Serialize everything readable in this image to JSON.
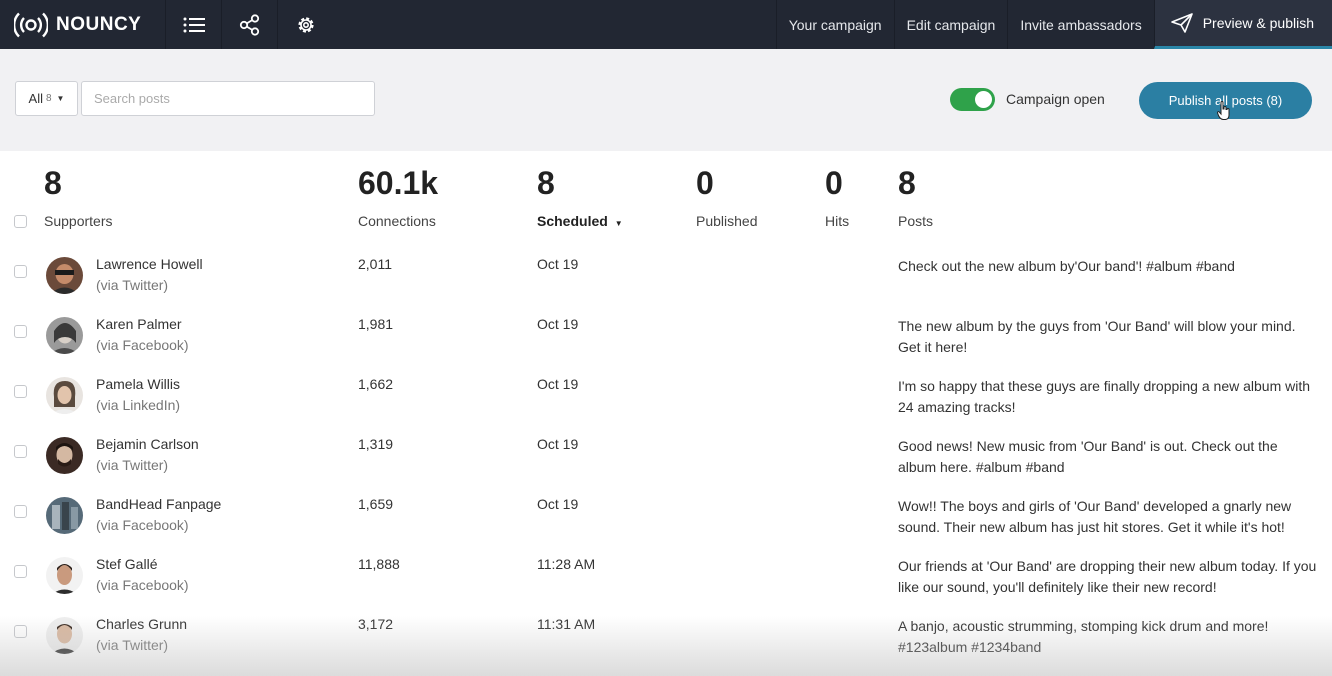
{
  "app": {
    "name": "NOUNCY"
  },
  "nav": {
    "links": [
      "Your campaign",
      "Edit campaign",
      "Invite ambassadors"
    ],
    "active_link": "Preview & publish"
  },
  "toolbar": {
    "filter_label": "All",
    "filter_count": "8",
    "search_placeholder": "Search posts",
    "toggle_label": "Campaign open",
    "toggle_on": true,
    "publish_label": "Publish all posts (8)"
  },
  "stats": [
    {
      "value": "8",
      "label": "Supporters"
    },
    {
      "value": "60.1k",
      "label": "Connections"
    },
    {
      "value": "8",
      "label": "Scheduled"
    },
    {
      "value": "0",
      "label": "Published"
    },
    {
      "value": "0",
      "label": "Hits"
    },
    {
      "value": "8",
      "label": "Posts"
    }
  ],
  "rows": [
    {
      "name": "Lawrence Howell",
      "via": "(via Twitter)",
      "connections": "2,011",
      "scheduled": "Oct 19",
      "post": "Check out the new album by'Our band'! #album #band"
    },
    {
      "name": "Karen Palmer",
      "via": "(via Facebook)",
      "connections": "1,981",
      "scheduled": "Oct 19",
      "post": "The new album by the guys from 'Our Band' will blow your mind. Get it here!"
    },
    {
      "name": "Pamela Willis",
      "via": "(via LinkedIn)",
      "connections": "1,662",
      "scheduled": "Oct 19",
      "post": "I'm so happy that these guys are finally dropping a new album with 24 amazing tracks!"
    },
    {
      "name": "Bejamin Carlson",
      "via": "(via Twitter)",
      "connections": "1,319",
      "scheduled": "Oct 19",
      "post": "Good news! New music from 'Our Band' is out. Check out the album here. #album #band"
    },
    {
      "name": "BandHead Fanpage",
      "via": "(via Facebook)",
      "connections": "1,659",
      "scheduled": "Oct 19",
      "post": "Wow!! The boys and girls of 'Our Band' developed a gnarly new sound. Their new album has just hit stores. Get it while it's hot!"
    },
    {
      "name": "Stef Gallé",
      "via": "(via Facebook)",
      "connections": "11,888",
      "scheduled": "11:28 AM",
      "post": "Our friends at 'Our Band' are dropping their new album today. If you like our sound, you'll definitely like their new record!"
    },
    {
      "name": "Charles Grunn",
      "via": "(via Twitter)",
      "connections": "3,172",
      "scheduled": "11:31 AM",
      "post": "A banjo, acoustic strumming, stomping kick drum and more! #123album #1234band"
    }
  ],
  "colors": {
    "nav_bg": "#222733",
    "accent": "#2b7fa3",
    "toggle_on": "#2fa24a",
    "toolbar_bg": "#f1f1f3"
  }
}
